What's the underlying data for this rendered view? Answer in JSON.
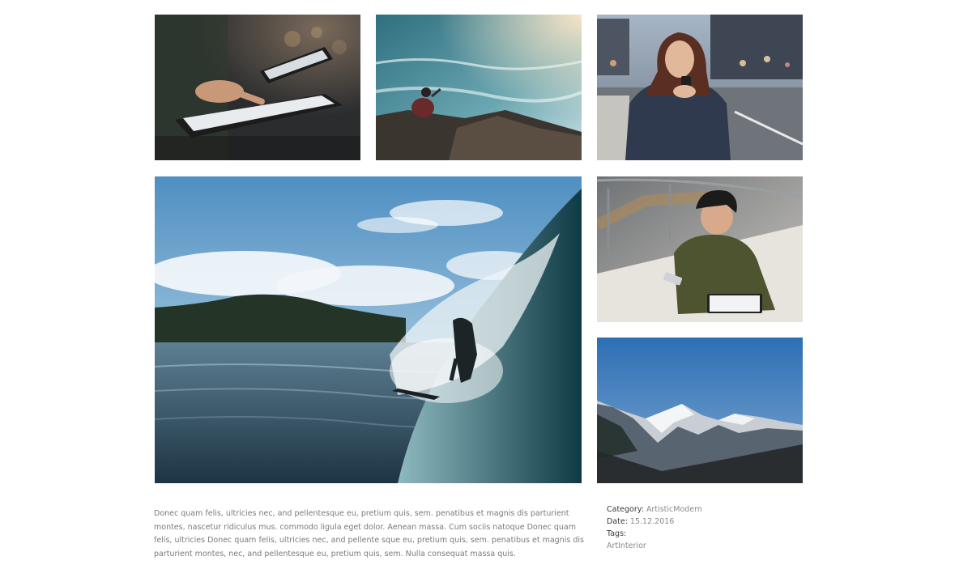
{
  "gallery": {
    "images": [
      {
        "subject": "hands-on-tablet"
      },
      {
        "subject": "person-on-sea-cliff"
      },
      {
        "subject": "woman-with-phone-on-street"
      },
      {
        "subject": "surfer-in-wave"
      },
      {
        "subject": "woman-on-bench-with-tablet"
      },
      {
        "subject": "snowy-mountains"
      }
    ]
  },
  "description": "Donec quam felis, ultricies nec, and pellentesque eu, pretium quis, sem. penatibus et magnis dis parturient montes, nascetur ridiculus mus. commodo ligula eget dolor. Aenean massa. Cum sociis natoque Donec quam felis, ultricies Donec quam felis, ultricies nec, and pellente sque eu, pretium quis, sem. penatibus et magnis dis parturient montes, nec, and pellentesque eu, pretium quis, sem. Nulla consequat massa quis.",
  "meta": {
    "category_label": "Category:",
    "category_value": "ArtisticModern",
    "date_label": "Date:",
    "date_value": "15.12.2016",
    "tags_label": "Tags:",
    "tags_value": "ArtInterior"
  }
}
